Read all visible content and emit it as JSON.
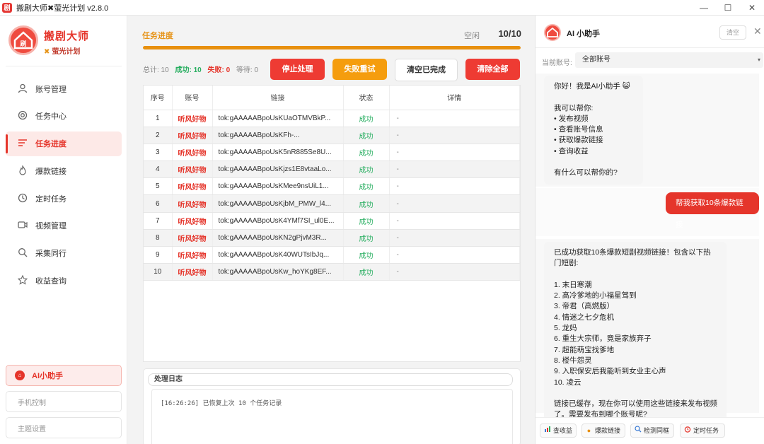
{
  "window": {
    "title": "搬剧大师✖萤光计划 v2.8.0",
    "controls": {
      "minimize": "—",
      "maximize": "☐",
      "close": "✕"
    }
  },
  "brand": {
    "logo_text": "刷",
    "title": "搬剧大师",
    "subtitle": "萤光计划"
  },
  "nav": {
    "items": [
      {
        "label": "账号管理",
        "icon": "user-icon"
      },
      {
        "label": "任务中心",
        "icon": "target-icon"
      },
      {
        "label": "任务进度",
        "icon": "list-icon"
      },
      {
        "label": "爆款链接",
        "icon": "fire-icon"
      },
      {
        "label": "定时任务",
        "icon": "clock-icon"
      },
      {
        "label": "视频管理",
        "icon": "video-icon"
      },
      {
        "label": "采集同行",
        "icon": "search-icon"
      },
      {
        "label": "收益查询",
        "icon": "star-icon"
      }
    ],
    "active_index": 2
  },
  "sidebar_bottom": {
    "ai": "AI小助手",
    "phone": "手机控制",
    "theme": "主题设置"
  },
  "progress": {
    "title": "任务进度",
    "status": "空闲",
    "count": "10/10",
    "fraction": 1.0,
    "stats": {
      "total": "总计: 10",
      "success": "成功: 10",
      "fail": "失败: 0",
      "waiting": "等待: 0"
    }
  },
  "buttons": {
    "stop": "停止处理",
    "retry": "失败重试",
    "clear_done": "清空已完成",
    "clear_all": "清除全部"
  },
  "table": {
    "headers": [
      "序号",
      "账号",
      "链接",
      "状态",
      "详情"
    ],
    "rows": [
      {
        "no": "1",
        "account": "听风好物",
        "link": "tok:gAAAAABpoUsKUaOTMVBkP...",
        "status": "成功",
        "detail": "-"
      },
      {
        "no": "2",
        "account": "听风好物",
        "link": "tok:gAAAAABpoUsKFh-...",
        "status": "成功",
        "detail": "-"
      },
      {
        "no": "3",
        "account": "听风好物",
        "link": "tok:gAAAAABpoUsK5nR885Se8U...",
        "status": "成功",
        "detail": "-"
      },
      {
        "no": "4",
        "account": "听风好物",
        "link": "tok:gAAAAABpoUsKjzs1E8vtaaLo...",
        "status": "成功",
        "detail": "-"
      },
      {
        "no": "5",
        "account": "听风好物",
        "link": "tok:gAAAAABpoUsKMee9nsUiL1...",
        "status": "成功",
        "detail": "-"
      },
      {
        "no": "6",
        "account": "听风好物",
        "link": "tok:gAAAAABpoUsKjbM_PMW_l4...",
        "status": "成功",
        "detail": "-"
      },
      {
        "no": "7",
        "account": "听风好物",
        "link": "tok:gAAAAABpoUsK4YMf7SI_ul0E...",
        "status": "成功",
        "detail": "-"
      },
      {
        "no": "8",
        "account": "听风好物",
        "link": "tok:gAAAAABpoUsKN2gPjvM3R...",
        "status": "成功",
        "detail": "-"
      },
      {
        "no": "9",
        "account": "听风好物",
        "link": "tok:gAAAAABpoUsK40WUTsIbJq...",
        "status": "成功",
        "detail": "-"
      },
      {
        "no": "10",
        "account": "听风好物",
        "link": "tok:gAAAAABpoUsKw_hoYKg8EF...",
        "status": "成功",
        "detail": "-"
      }
    ]
  },
  "log": {
    "title": "处理日志",
    "lines": [
      "[16:26:26] 已恢复上次 10 个任务记录"
    ]
  },
  "assistant": {
    "title": "AI 小助手",
    "clear": "清空",
    "close": "✕",
    "account_label": "当前账号:",
    "account_value": "全部账号",
    "messages": {
      "greeting": "你好！我是AI小助手 😺\n\n我可以帮你:\n• 发布视频\n• 查看账号信息\n• 获取爆款链接\n• 查询收益\n\n有什么可以帮你的?",
      "user": "帮我获取10条爆款链接",
      "reply": "已成功获取10条爆款短剧视频链接！包含以下热\n门短剧:\n\n1. 末日寒潮\n2. 高冷爹地的小福星驾到\n3. 帝君（高燃版）\n4. 情迷之七夕危机\n5. 龙妈\n6. 重生大宗师，竟是家族弃子\n7. 超能萌宝找爹地\n8. 楼牛怨灵\n9. 入职保安后我能听到女业主心声\n10. 凌云\n\n链接已缓存，现在你可以使用这些链接来发布视频\n了。需要发布到哪个账号呢?"
    },
    "quick_actions": [
      {
        "label": "查收益",
        "icon": "chart-icon"
      },
      {
        "label": "爆款链接",
        "icon": "fire-icon"
      },
      {
        "label": "检测同框",
        "icon": "search-icon"
      },
      {
        "label": "定时任务",
        "icon": "alarm-icon"
      }
    ]
  },
  "colors": {
    "brand_red": "#e5352b",
    "progress_orange": "#e8900e",
    "success_green": "#27ae60"
  }
}
